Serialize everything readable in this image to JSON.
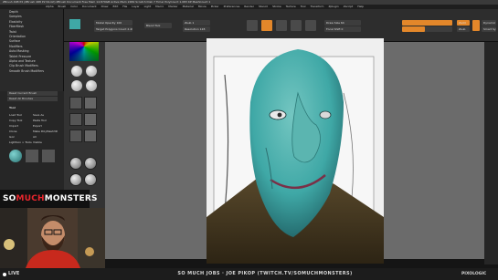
{
  "app": {
    "title_text": "ZBrush 4R8 P2 (ZBrush 4R8 P2 64-bit)  ZBrush Document  Free Mem 14.879GB  Active Mem 2484  Scratch Disk 7 Timer  PolyCount 1.083 KP  MeshCount 1"
  },
  "menu": {
    "items": [
      "Alpha",
      "Brush",
      "Color",
      "Document",
      "Draw",
      "Edit",
      "File",
      "Layer",
      "Light",
      "Macro",
      "Marker",
      "Material",
      "Movie",
      "Picker",
      "Preferences",
      "Render",
      "Stencil",
      "Stroke",
      "Texture",
      "Tool",
      "Transform",
      "Zplugin",
      "Zscript",
      "Help"
    ]
  },
  "left_panel": {
    "items": [
      "Depth",
      "Samples",
      "Elasticity",
      "FiberMesh",
      "Twist",
      "Orientation",
      "Surface",
      "Modifiers",
      "Auto Masking",
      "Tablet Pressure",
      "Alpha and Texture",
      "Clip Brush Modifiers",
      "Smooth Brush Modifiers"
    ],
    "lower": {
      "buttons": [
        "Reset Current Brush",
        "Reset All Brushes"
      ],
      "tool_label": "Tool",
      "tool_rows": [
        "Load Tool",
        "Copy Tool",
        "Import",
        "Clone",
        "Goz",
        "Lightbox > Tools"
      ],
      "tool_rows_right": [
        "Save As",
        "Paste Tool",
        "Export",
        "Make PolyMesh3D",
        "All",
        "Visible"
      ]
    }
  },
  "toolbar": {
    "fields": [
      {
        "label": "Model Opacity 100"
      },
      {
        "label": "Blend Tool",
        "label2": "Target Polygons Count 2.49869"
      },
      {
        "label": "Zsub 1"
      },
      {
        "label": "Resolution 128"
      },
      {
        "label": "Draw Size 64"
      },
      {
        "label": "Focal Shift 0"
      },
      {
        "label": "Rgb Intensity 100"
      },
      {
        "label": "Z Intensity 45"
      }
    ],
    "buttons": [
      "Edit",
      "Draw",
      "Move",
      "Scale",
      "Rotate"
    ],
    "mode_buttons": [
      "Mrgb",
      "Rgb",
      "M"
    ],
    "zadd_label": "Zadd",
    "zsub_label": "Zsub",
    "right_labels": [
      "Dynamic",
      "Smart Sym"
    ]
  },
  "overlay": {
    "banner_part1": "SO",
    "banner_part2": "MUCH",
    "banner_part3": "MONSTERS",
    "live_label": "LIVE",
    "show_title": "SO MUCH JOBS · JOE PIKOP (TWITCH.TV/SOMUCHMONSTERS)",
    "brand": "PIXOLOGIC"
  },
  "colors": {
    "accent": "#e3872a",
    "banner_red": "#e8262d",
    "model_teal": "#3fa8a6"
  }
}
